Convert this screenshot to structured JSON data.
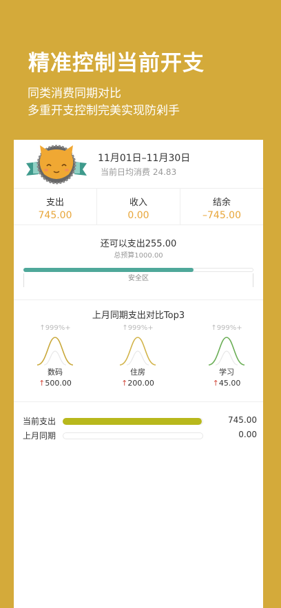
{
  "promo": {
    "headline": "精准控制当前开支",
    "line1": "同类消费同期对比",
    "line2": "多重开支控制完美实现防剁手"
  },
  "header": {
    "date_range": "11月01日–11月30日",
    "avg_label": "当前日均消费",
    "avg_value": "24.83"
  },
  "stats": [
    {
      "label": "支出",
      "value": "745.00"
    },
    {
      "label": "收入",
      "value": "0.00"
    },
    {
      "label": "结余",
      "value": "–745.00"
    }
  ],
  "budget": {
    "remaining_text": "还可以支出255.00",
    "total_text": "总预算1000.00",
    "progress": 0.745,
    "zone_label": "安全区",
    "bar_color": "#4FA89A"
  },
  "comparison": {
    "title": "上月同期支出对比Top3",
    "categories": [
      {
        "pct": "↑999%+",
        "name": "数码",
        "arrow": "↑",
        "amount": "500.00",
        "curve_color": "#C9A83A"
      },
      {
        "pct": "↑999%+",
        "name": "住房",
        "arrow": "↑",
        "amount": "200.00",
        "curve_color": "#D2B44A"
      },
      {
        "pct": "↑999%+",
        "name": "学习",
        "arrow": "↑",
        "amount": "45.00",
        "curve_color": "#6AAE55"
      }
    ]
  },
  "spending": {
    "current_label": "当前支出",
    "current_value": "745.00",
    "current_progress": 1.0,
    "last_label": "上月同期",
    "last_value": "0.00",
    "last_progress": 0.0,
    "bar_color": "#B8B81C"
  }
}
